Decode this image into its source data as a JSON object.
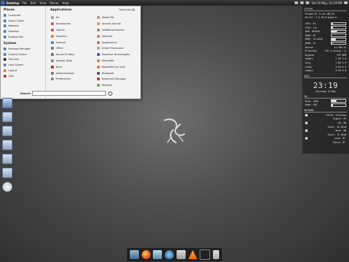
{
  "topbar": {
    "app": "Desktop",
    "menu": [
      "File",
      "Edit",
      "View",
      "Places",
      "Help"
    ],
    "clock": "Sat 14 May, 21:19 PM"
  },
  "places": {
    "title": "Places",
    "items": [
      "Computer",
      "Home Folder",
      "Network",
      "Desktop",
      "Rubbish Bin"
    ]
  },
  "system": {
    "title": "System",
    "items": [
      "Package Manager",
      "Control Centre",
      "Terminal",
      "Lock Screen",
      "Logout",
      "Quit"
    ]
  },
  "applications": {
    "title": "Applications",
    "favourites": "Favourites",
    "items": [
      "All",
      "About Me",
      "Accessories",
      "Activity Journal",
      "Games",
      "Additional Drivers",
      "Graphics",
      "Alacarte",
      "Internet",
      "Appearance",
      "Office",
      "Arista Transcoder",
      "Sound & Video",
      "Assistive Technologies",
      "System Tools",
      "BleachBit",
      "Wine",
      "BleachBit (as root)",
      "Administration",
      "Bluetooth",
      "Preferences",
      "Bootchart-Manager",
      "",
      "Boxeeio"
    ]
  },
  "search": {
    "label": "Search:",
    "placeholder": ""
  },
  "conky": {
    "system": "SYSTEM",
    "host": "Pisgah OS 11.04 x86_64",
    "kernel": "Kernel: 2.6.38-8-generic",
    "rows": [
      {
        "label": "CPU1: 8%",
        "fill": 0.08
      },
      {
        "label": "CPU2: 11%",
        "fill": 0.11
      },
      {
        "label": "RAM: 853MiB",
        "fill": 0.4
      },
      {
        "label": "SWAP: 0%",
        "fill": 0.0
      },
      {
        "label": "ROOT: 16.8GiB",
        "fill": 0.3
      },
      {
        "label": "HOME: 4%",
        "fill": 0.04
      }
    ],
    "uptime_label": "Uptime",
    "uptime": "1h 38m 2s",
    "processes_label": "Processes",
    "processes": "195 (running: 1)",
    "highest": "Highest",
    "cpu": "CPU",
    "mem": "MEM",
    "procs": [
      [
        "compiz",
        "1.50",
        "5.0"
      ],
      [
        "Xorg",
        "1.00",
        "5.9"
      ],
      [
        "conky",
        "0.50",
        "0.3"
      ],
      [
        "compiz",
        "0.50",
        "0.0"
      ]
    ],
    "date_hdr": "DATE",
    "time": "23:19",
    "date": "Saturday 14 May",
    "hd_hdr": "HD",
    "hd1": "Root: 16Gb",
    "hd2": "Home: 4Gb",
    "network_hdr": "NETWORK",
    "net": [
      "ESSID: officeap",
      "Signal: 0%",
      "Up: 0B",
      "Total: 16.9MiB",
      "Down: 0B",
      "Total: 75.1MiB",
      "Local IP:",
      "Public IP:"
    ]
  },
  "colors": {
    "accent": "#2a6fb7",
    "menu_bg": "#f2f2f2"
  }
}
